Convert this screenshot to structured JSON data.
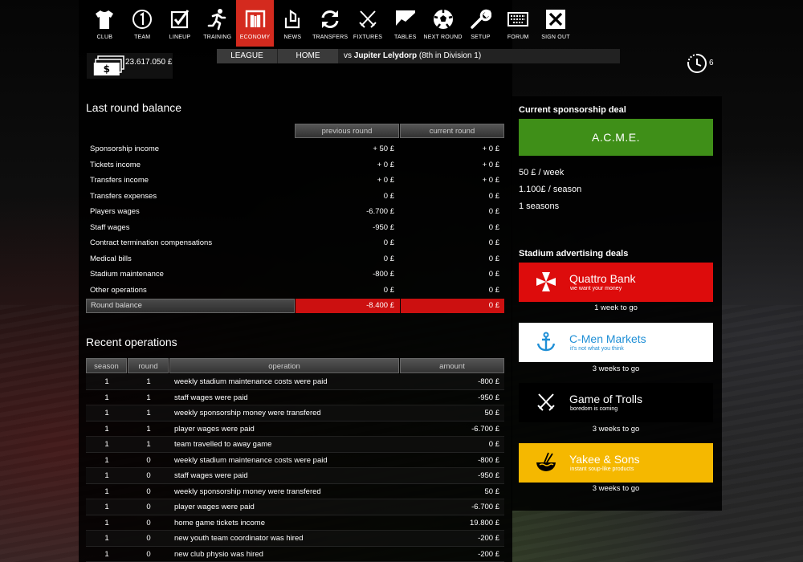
{
  "nav": [
    {
      "label": "CLUB",
      "icon": "shirt-icon"
    },
    {
      "label": "TEAM",
      "icon": "number-one-icon"
    },
    {
      "label": "LINEUP",
      "icon": "checkbox-icon"
    },
    {
      "label": "TRAINING",
      "icon": "runner-icon"
    },
    {
      "label": "ECONOMY",
      "icon": "economy-icon",
      "active": true
    },
    {
      "label": "NEWS",
      "icon": "news-icon"
    },
    {
      "label": "TRANSFERS",
      "icon": "transfer-arrows-icon"
    },
    {
      "label": "FIXTURES",
      "icon": "crossed-swords-icon"
    },
    {
      "label": "TABLES",
      "icon": "chart-icon"
    },
    {
      "label": "NEXT ROUND",
      "icon": "ball-icon"
    },
    {
      "label": "SETUP",
      "icon": "wrench-icon"
    },
    {
      "label": "FORUM",
      "icon": "keyboard-icon"
    },
    {
      "label": "SIGN OUT",
      "icon": "close-box-icon"
    }
  ],
  "money": {
    "value": "23.617.050 £"
  },
  "match": {
    "league": "LEAGUE",
    "home": "HOME",
    "vs": "vs ",
    "opponent": "Jupiter Lelydorp",
    "position": " (8th in Division 1)"
  },
  "clock": {
    "count": "6"
  },
  "balance": {
    "title": "Last round balance",
    "col_prev": "previous round",
    "col_curr": "current round",
    "rows": [
      {
        "label": "Sponsorship income",
        "prev": "+ 50 £",
        "curr": "+ 0 £"
      },
      {
        "label": "Tickets income",
        "prev": "+ 0 £",
        "curr": "+ 0 £"
      },
      {
        "label": "Transfers income",
        "prev": "+ 0 £",
        "curr": "+ 0 £"
      },
      {
        "label": "Transfers expenses",
        "prev": "0 £",
        "curr": "0 £"
      },
      {
        "label": "Players wages",
        "prev": "-6.700 £",
        "curr": "0 £"
      },
      {
        "label": "Staff wages",
        "prev": "-950 £",
        "curr": "0 £"
      },
      {
        "label": "Contract termination compensations",
        "prev": "0 £",
        "curr": "0 £"
      },
      {
        "label": "Medical bills",
        "prev": "0 £",
        "curr": "0 £"
      },
      {
        "label": "Stadium maintenance",
        "prev": "-800 £",
        "curr": "0 £"
      },
      {
        "label": "Other operations",
        "prev": "0 £",
        "curr": "0 £"
      }
    ],
    "total_label": "Round balance",
    "total_prev": "-8.400 £",
    "total_curr": "0 £"
  },
  "operations": {
    "title": "Recent operations",
    "headers": {
      "season": "season",
      "round": "round",
      "operation": "operation",
      "amount": "amount"
    },
    "rows": [
      {
        "season": "1",
        "round": "1",
        "operation": "weekly stadium maintenance costs were paid",
        "amount": "-800 £"
      },
      {
        "season": "1",
        "round": "1",
        "operation": "staff wages were paid",
        "amount": "-950 £"
      },
      {
        "season": "1",
        "round": "1",
        "operation": "weekly sponsorship money were transfered",
        "amount": "50 £"
      },
      {
        "season": "1",
        "round": "1",
        "operation": "player wages were paid",
        "amount": "-6.700 £"
      },
      {
        "season": "1",
        "round": "1",
        "operation": "team travelled to away game",
        "amount": "0 £"
      },
      {
        "season": "1",
        "round": "0",
        "operation": "weekly stadium maintenance costs were paid",
        "amount": "-800 £"
      },
      {
        "season": "1",
        "round": "0",
        "operation": "staff wages were paid",
        "amount": "-950 £"
      },
      {
        "season": "1",
        "round": "0",
        "operation": "weekly sponsorship money were transfered",
        "amount": "50 £"
      },
      {
        "season": "1",
        "round": "0",
        "operation": "player wages were paid",
        "amount": "-6.700 £"
      },
      {
        "season": "1",
        "round": "0",
        "operation": "home game tickets income",
        "amount": "19.800 £"
      },
      {
        "season": "1",
        "round": "0",
        "operation": "new youth team coordinator was hired",
        "amount": "-200 £"
      },
      {
        "season": "1",
        "round": "0",
        "operation": "new club physio was hired",
        "amount": "-200 £"
      }
    ]
  },
  "sponsorship": {
    "title": "Current sponsorship deal",
    "name": "A.C.M.E.",
    "weekly": "50 £ / week",
    "season": "1.100£ / season",
    "seasons": "1 seasons",
    "color": "#3f8f18"
  },
  "advertising": {
    "title": "Stadium advertising deals",
    "deals": [
      {
        "name": "Quattro Bank",
        "slogan": "we want your money",
        "duration": "1 week to go",
        "bg": "#dd0c0c",
        "fg": "#ffffff",
        "icon": "cross-pattee-icon"
      },
      {
        "name": "C-Men Markets",
        "slogan": "it's not what you think",
        "duration": "3 weeks to go",
        "bg": "#ffffff",
        "fg": "#1f8fd6",
        "icon": "anchor-icon"
      },
      {
        "name": "Game of Trolls",
        "slogan": "boredom is coming",
        "duration": "3 weeks to go",
        "bg": "#000000",
        "fg": "#ffffff",
        "icon": "crossed-swords-icon"
      },
      {
        "name": "Yakee & Sons",
        "slogan": "instant soup-like products",
        "duration": "3 weeks to go",
        "bg": "#f5b800",
        "fg": "#ffffff",
        "icon": "noodle-bowl-icon"
      }
    ]
  }
}
